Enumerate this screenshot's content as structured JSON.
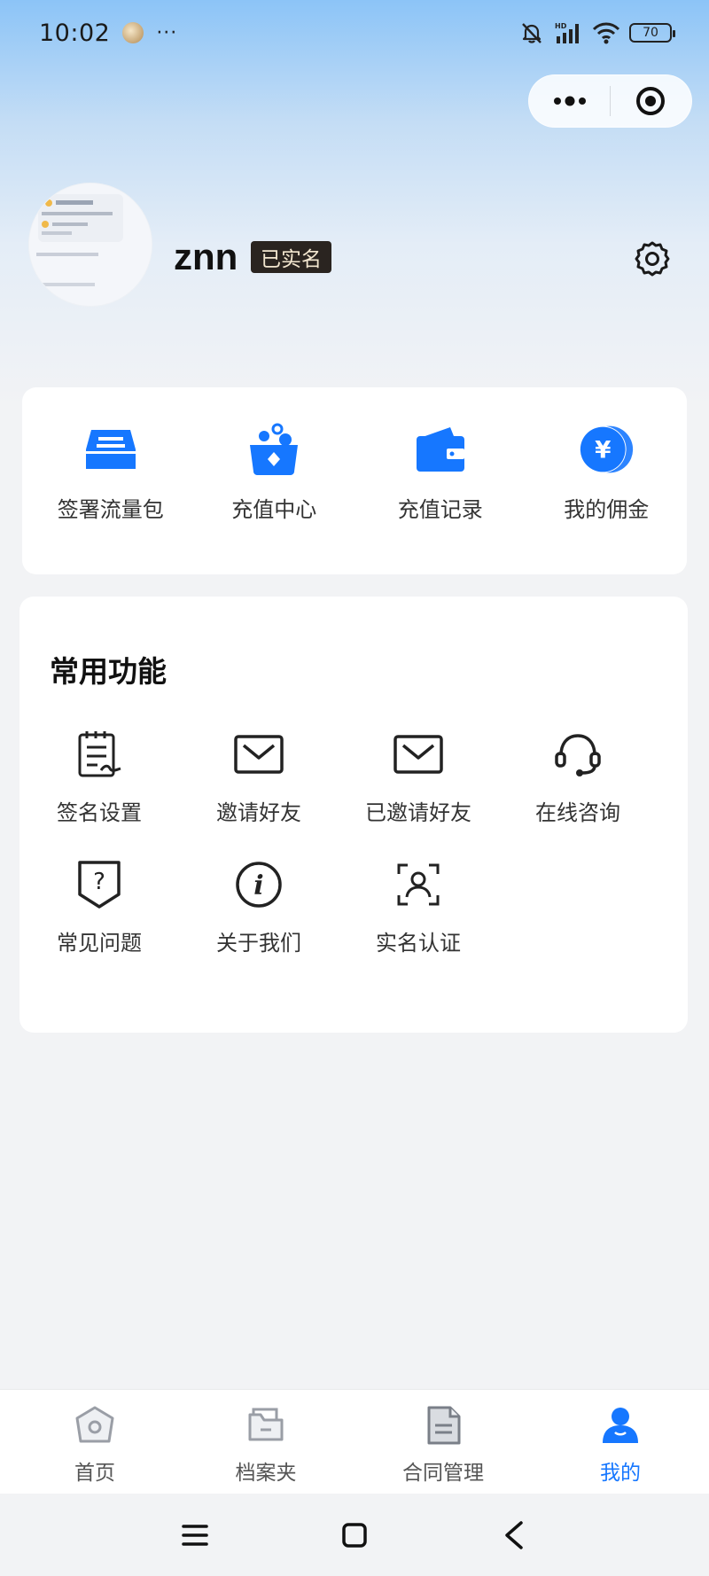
{
  "status_bar": {
    "time": "10:02",
    "dots": "···",
    "battery": "70",
    "network": "HD"
  },
  "profile": {
    "username": "znn",
    "verified_label": "已实名"
  },
  "wallet": {
    "items": [
      {
        "label": "签署流量包",
        "icon": "tray-icon"
      },
      {
        "label": "充值中心",
        "icon": "recharge-box-icon"
      },
      {
        "label": "充值记录",
        "icon": "wallet-icon"
      },
      {
        "label": "我的佣金",
        "icon": "yen-coin-icon"
      }
    ]
  },
  "functions": {
    "title": "常用功能",
    "items": [
      {
        "label": "签名设置",
        "icon": "signature-note-icon"
      },
      {
        "label": "邀请好友",
        "icon": "envelope-icon"
      },
      {
        "label": "已邀请好友",
        "icon": "envelope-icon"
      },
      {
        "label": "在线咨询",
        "icon": "headset-icon"
      },
      {
        "label": "常见问题",
        "icon": "question-shield-icon"
      },
      {
        "label": "关于我们",
        "icon": "info-circle-icon"
      },
      {
        "label": "实名认证",
        "icon": "face-scan-icon"
      }
    ]
  },
  "tab_bar": {
    "tabs": [
      {
        "label": "首页",
        "icon": "home-icon",
        "active": false
      },
      {
        "label": "档案夹",
        "icon": "folder-icon",
        "active": false
      },
      {
        "label": "合同管理",
        "icon": "document-icon",
        "active": false
      },
      {
        "label": "我的",
        "icon": "user-icon",
        "active": true
      }
    ]
  },
  "colors": {
    "accent": "#1677ff",
    "badge_bg": "#2a2420",
    "badge_text": "#f3e7d0"
  }
}
